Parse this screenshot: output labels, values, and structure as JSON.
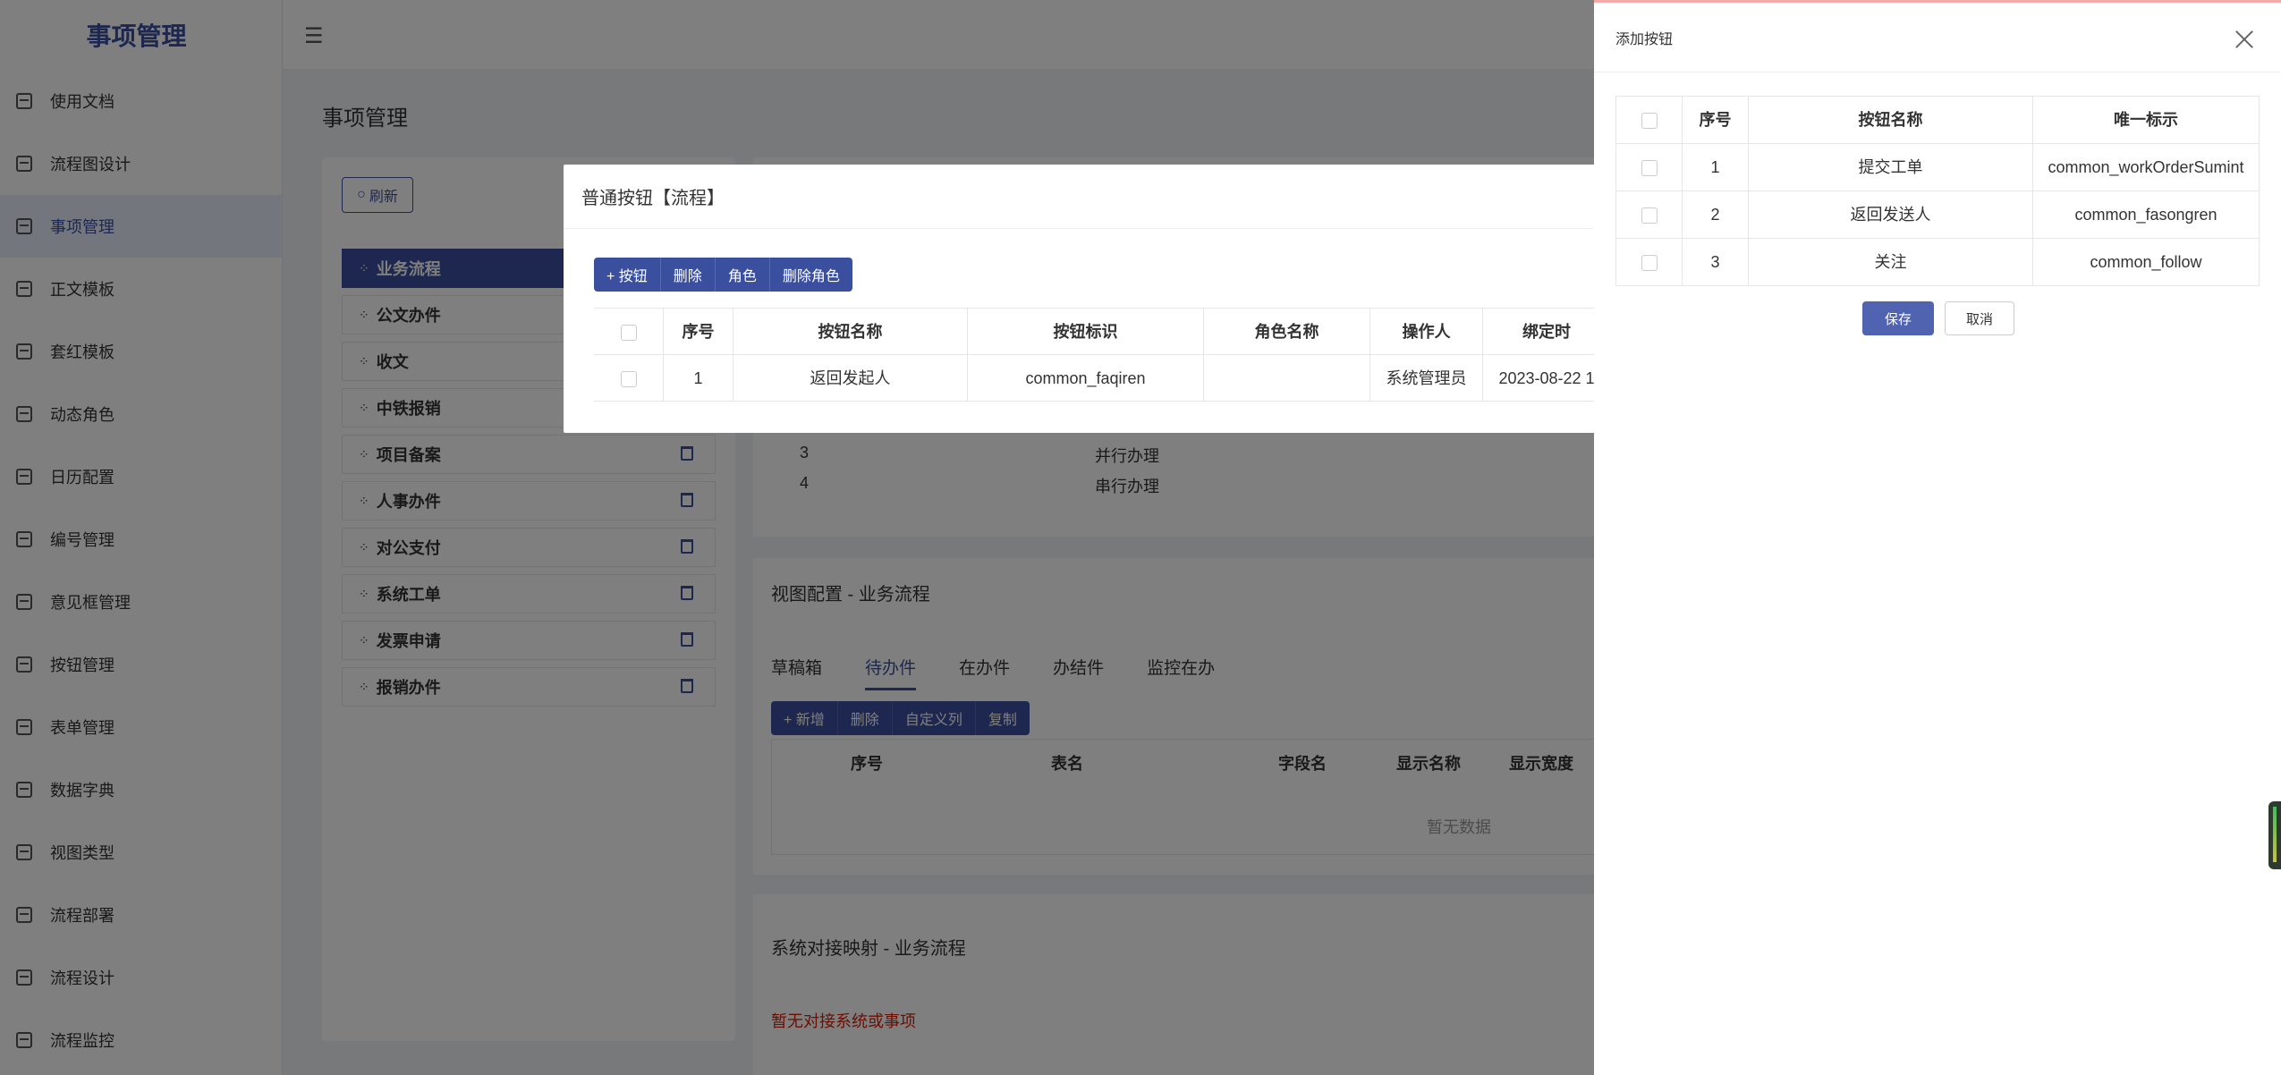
{
  "app": {
    "title": "事项管理"
  },
  "sidebar": {
    "items": [
      {
        "label": "使用文档",
        "icon": "document-icon"
      },
      {
        "label": "流程图设计",
        "icon": "flow-chart-icon"
      },
      {
        "label": "事项管理",
        "icon": "database-icon",
        "active": true
      },
      {
        "label": "正文模板",
        "icon": "file-template-icon"
      },
      {
        "label": "套红模板",
        "icon": "red-template-icon"
      },
      {
        "label": "动态角色",
        "icon": "user-icon"
      },
      {
        "label": "日历配置",
        "icon": "calendar-icon"
      },
      {
        "label": "编号管理",
        "icon": "bar-chart-icon"
      },
      {
        "label": "意见框管理",
        "icon": "comment-box-icon"
      },
      {
        "label": "按钮管理",
        "icon": "button-icon"
      },
      {
        "label": "表单管理",
        "icon": "table-icon"
      },
      {
        "label": "数据字典",
        "icon": "dictionary-icon"
      },
      {
        "label": "视图类型",
        "icon": "eye-icon"
      },
      {
        "label": "流程部署",
        "icon": "deploy-icon"
      },
      {
        "label": "流程设计",
        "icon": "list-icon"
      },
      {
        "label": "流程监控",
        "icon": "sliders-icon"
      }
    ]
  },
  "page": {
    "title": "事项管理",
    "refresh_label": "刷新"
  },
  "tree": {
    "items": [
      "业务流程",
      "公文办件",
      "收文",
      "中铁报销",
      "项目备案",
      "人事办件",
      "对公支付",
      "系统工单",
      "发票申请",
      "报销办件"
    ]
  },
  "background_rows": [
    {
      "index": "3",
      "name": "并行办理"
    },
    {
      "index": "4",
      "name": "串行办理"
    }
  ],
  "view_config": {
    "title": "视图配置 - 业务流程",
    "tabs": [
      "草稿箱",
      "待办件",
      "在办件",
      "办结件",
      "监控在办"
    ],
    "active_tab": "待办件",
    "buttons": [
      "+ 新增",
      "删除",
      "自定义列",
      "复制"
    ],
    "columns": [
      "序号",
      "表名",
      "字段名",
      "显示名称",
      "显示宽度"
    ],
    "empty_text": "暂无数据"
  },
  "system_mapping": {
    "title": "系统对接映射 - 业务流程",
    "empty_text": "暂无对接系统或事项"
  },
  "button_dialog": {
    "title": "普通按钮【流程】",
    "toolbar": [
      "+ 按钮",
      "删除",
      "角色",
      "删除角色"
    ],
    "columns": [
      "序号",
      "按钮名称",
      "按钮标识",
      "角色名称",
      "操作人",
      "绑定时"
    ],
    "rows": [
      {
        "index": "1",
        "name": "返回发起人",
        "key": "common_faqiren",
        "role": "",
        "operator": "系统管理员",
        "time": "2023-08-22 1"
      }
    ]
  },
  "add_drawer": {
    "title": "添加按钮",
    "columns": [
      "序号",
      "按钮名称",
      "唯一标示"
    ],
    "rows": [
      {
        "index": "1",
        "name": "提交工单",
        "key": "common_workOrderSumint"
      },
      {
        "index": "2",
        "name": "返回发送人",
        "key": "common_fasongren"
      },
      {
        "index": "3",
        "name": "关注",
        "key": "common_follow"
      }
    ],
    "save_label": "保存",
    "cancel_label": "取消"
  }
}
